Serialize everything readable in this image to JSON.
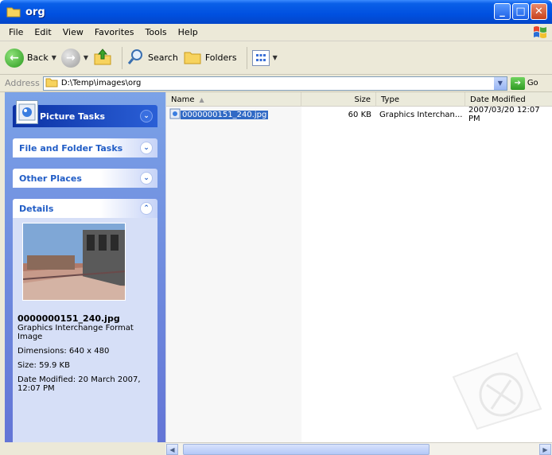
{
  "window": {
    "title": "org"
  },
  "menu": [
    "File",
    "Edit",
    "View",
    "Favorites",
    "Tools",
    "Help"
  ],
  "toolbar": {
    "back_label": "Back",
    "search_label": "Search",
    "folders_label": "Folders"
  },
  "address": {
    "label": "Address",
    "path": "D:\\Temp\\images\\org",
    "go_label": "Go"
  },
  "taskpane": {
    "picture_tasks": "Picture Tasks",
    "file_folder_tasks": "File and Folder Tasks",
    "other_places": "Other Places",
    "details": "Details",
    "details_info": {
      "filename": "0000000151_240.jpg",
      "type": "Graphics Interchange Format Image",
      "dimensions": "Dimensions: 640 x 480",
      "size": "Size: 59.9 KB",
      "modified": "Date Modified: 20 March 2007, 12:07 PM"
    }
  },
  "columns": {
    "name": "Name",
    "size": "Size",
    "type": "Type",
    "date": "Date Modified"
  },
  "files": [
    {
      "name": "0000000151_240.jpg",
      "size": "60 KB",
      "type": "Graphics Interchan...",
      "date": "2007/03/20 12:07 PM"
    }
  ]
}
